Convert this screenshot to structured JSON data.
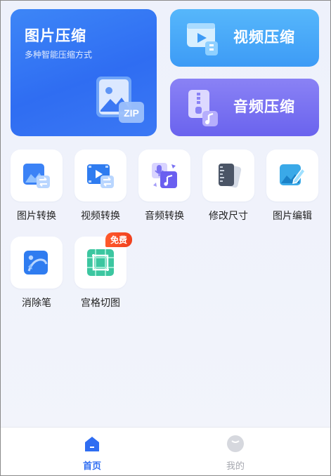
{
  "cards": {
    "image_compress": {
      "title": "图片压缩",
      "subtitle": "多种智能压缩方式",
      "zip_text": "ZIP"
    },
    "video_compress": {
      "title": "视频压缩"
    },
    "audio_compress": {
      "title": "音频压缩"
    }
  },
  "tools": [
    {
      "label": "图片转换",
      "icon": "image-convert-icon"
    },
    {
      "label": "视频转换",
      "icon": "video-convert-icon"
    },
    {
      "label": "音频转换",
      "icon": "audio-convert-icon"
    },
    {
      "label": "修改尺寸",
      "icon": "resize-icon"
    },
    {
      "label": "图片编辑",
      "icon": "image-edit-icon"
    },
    {
      "label": "消除笔",
      "icon": "eraser-pen-icon"
    },
    {
      "label": "宫格切图",
      "icon": "grid-crop-icon",
      "badge": "免费"
    }
  ],
  "tabbar": {
    "home": {
      "label": "首页",
      "active": true
    },
    "mine": {
      "label": "我的",
      "active": false
    }
  },
  "colors": {
    "primary": "#2f6df2",
    "video_card": "#4aa8f8",
    "audio_card": "#7a72f2",
    "badge": "#f0401e",
    "inactive_tab": "#a6a8b0"
  }
}
